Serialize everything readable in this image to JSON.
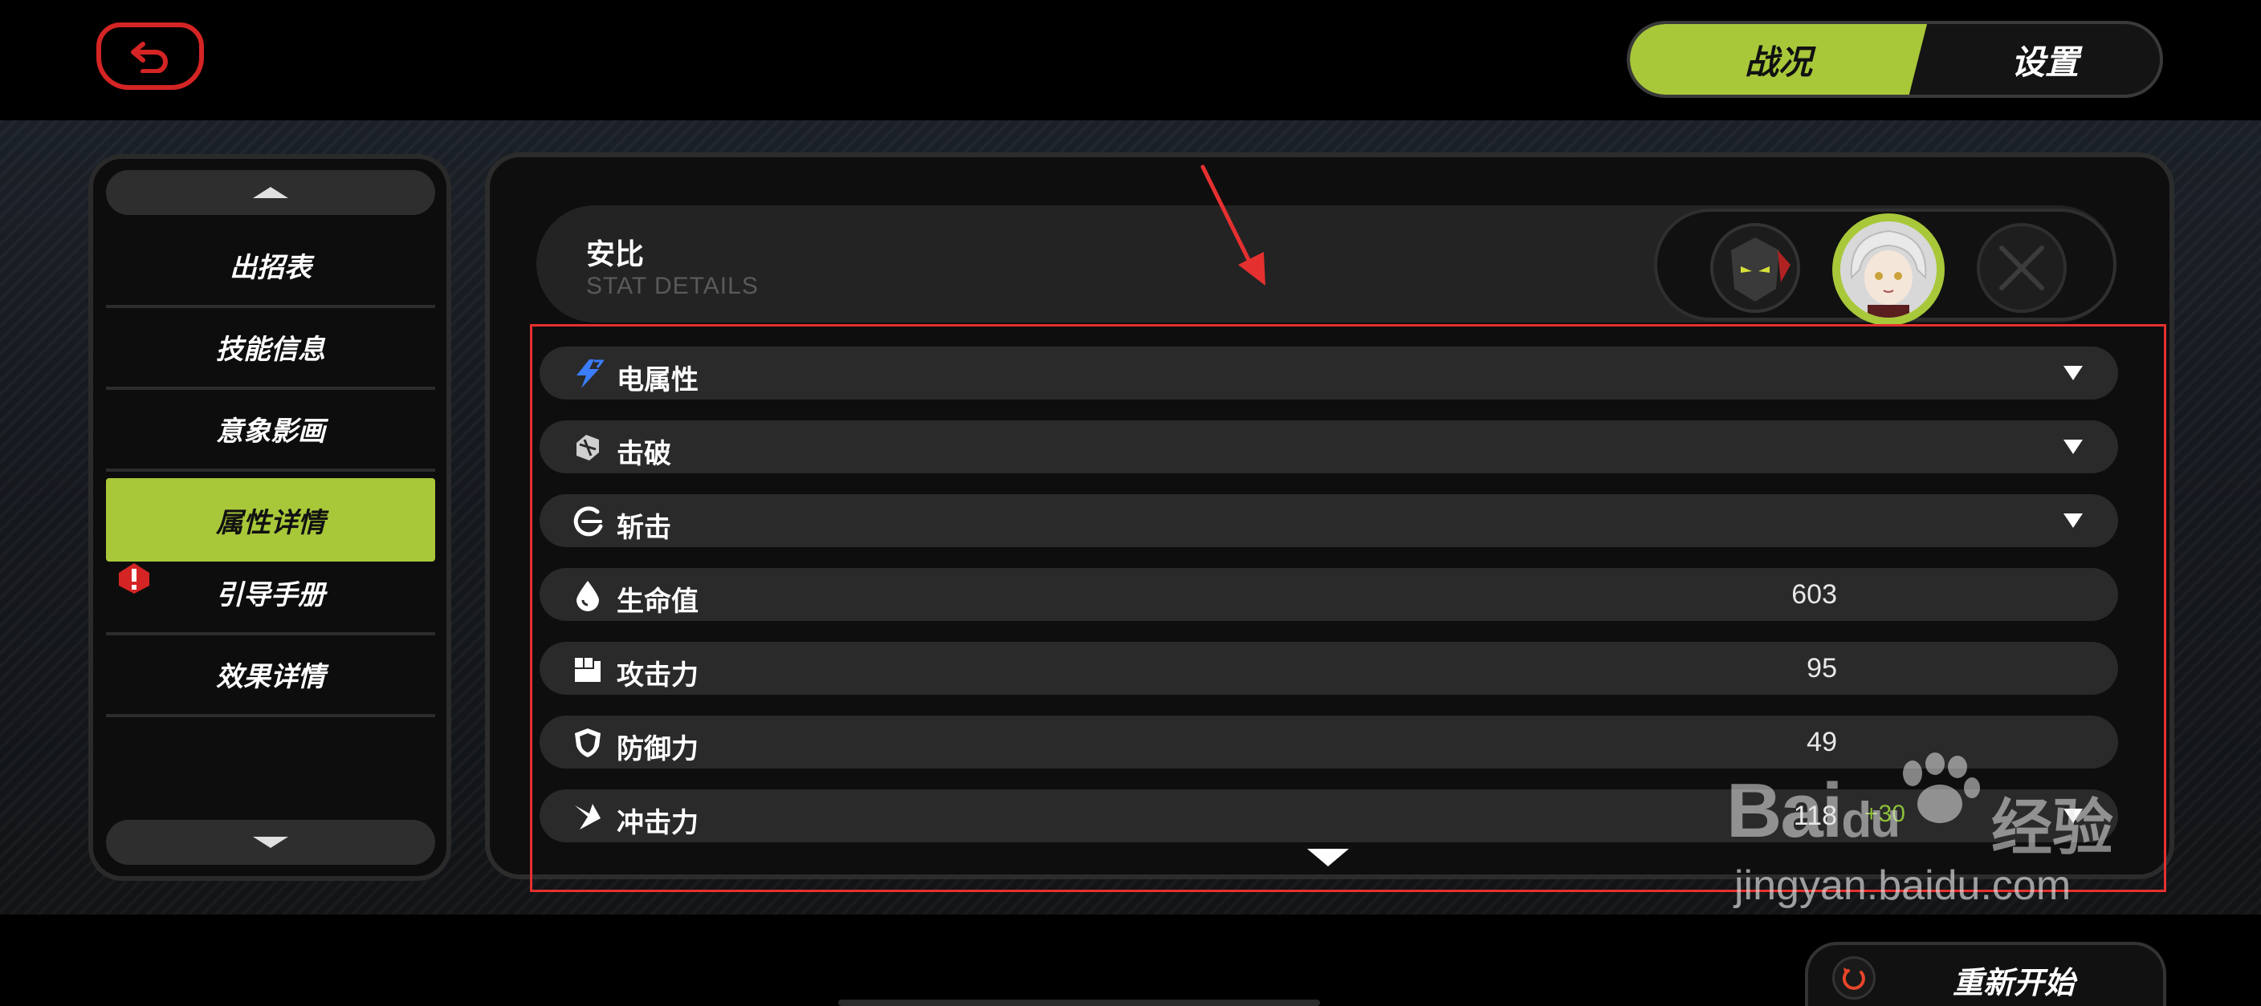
{
  "top": {
    "mode_tabs": [
      {
        "label": "战况",
        "active": true
      },
      {
        "label": "设置",
        "active": false
      }
    ],
    "accent_color": "#a8c83a",
    "back_icon": "back-arrow-icon"
  },
  "sidebar": {
    "items": [
      {
        "label": "出招表",
        "active": false
      },
      {
        "label": "技能信息",
        "active": false
      },
      {
        "label": "意象影画",
        "active": false
      },
      {
        "label": "属性详情",
        "active": true
      },
      {
        "label": "引导手册",
        "active": false,
        "alert": true
      },
      {
        "label": "效果详情",
        "active": false
      }
    ]
  },
  "character": {
    "name": "安比",
    "subtitle": "STAT DETAILS"
  },
  "stats": [
    {
      "label": "电属性",
      "icon": "electric-icon",
      "value": "",
      "expandable": true
    },
    {
      "label": "击破",
      "icon": "break-icon",
      "value": "",
      "expandable": true
    },
    {
      "label": "斩击",
      "icon": "slash-icon",
      "value": "",
      "expandable": true
    },
    {
      "label": "生命值",
      "icon": "hp-drop-icon",
      "value": "603",
      "expandable": false
    },
    {
      "label": "攻击力",
      "icon": "attack-fist-icon",
      "value": "95",
      "expandable": false
    },
    {
      "label": "防御力",
      "icon": "defense-shield-icon",
      "value": "49",
      "expandable": false
    },
    {
      "label": "冲击力",
      "icon": "impact-icon",
      "value": "118",
      "bonus": "+30",
      "expandable": true
    }
  ],
  "footer": {
    "restart_label": "重新开始"
  },
  "watermark": {
    "logo": "Bai",
    "logo2": "du",
    "cn": "经验",
    "url": "jingyan.baidu.com"
  }
}
